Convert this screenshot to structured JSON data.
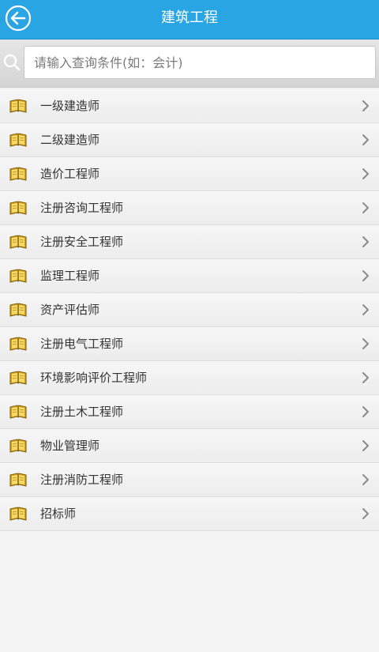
{
  "header": {
    "title": "建筑工程",
    "back_icon": "back-arrow-icon",
    "background_color": "#2aa5e3"
  },
  "search": {
    "placeholder": "请输入查询条件(如：会计)",
    "value": "",
    "icon": "search-icon"
  },
  "list": {
    "item_icon": "book-icon",
    "chevron_icon": "chevron-right-icon",
    "items": [
      {
        "label": "一级建造师"
      },
      {
        "label": "二级建造师"
      },
      {
        "label": "造价工程师"
      },
      {
        "label": "注册咨询工程师"
      },
      {
        "label": "注册安全工程师"
      },
      {
        "label": "监理工程师"
      },
      {
        "label": "资产评估师"
      },
      {
        "label": "注册电气工程师"
      },
      {
        "label": "环境影响评价工程师"
      },
      {
        "label": "注册土木工程师"
      },
      {
        "label": "物业管理师"
      },
      {
        "label": "注册消防工程师"
      },
      {
        "label": "招标师"
      }
    ]
  }
}
